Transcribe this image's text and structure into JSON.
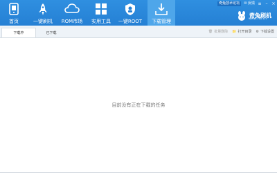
{
  "nav": [
    {
      "label": "首页",
      "icon": "phone-icon"
    },
    {
      "label": "一键刷机",
      "icon": "rocket-icon"
    },
    {
      "label": "ROM市场",
      "icon": "cloud-icon"
    },
    {
      "label": "实用工具",
      "icon": "grid-icon"
    },
    {
      "label": "一键ROOT",
      "icon": "shield-icon"
    },
    {
      "label": "下载管理",
      "icon": "download-icon"
    }
  ],
  "active_nav": "下载管理",
  "topright": {
    "forum": "奇兔技术论坛",
    "feedback": "反馈"
  },
  "brand": {
    "name": "奇兔刷机",
    "url": "www.7to.cn"
  },
  "tabs": [
    {
      "label": "下载中"
    },
    {
      "label": "已下载"
    }
  ],
  "tools": {
    "delete": "批量删除",
    "open_dir": "打开目录",
    "settings": "下载设置"
  },
  "empty_message": "目前没有正在下载的任务",
  "colors": {
    "topbar": "#2580d4",
    "active": "#4ea6ea"
  }
}
